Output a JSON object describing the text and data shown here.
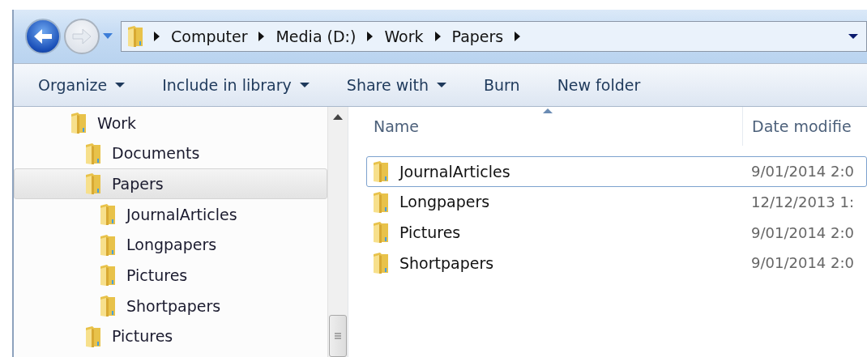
{
  "address_bar": {
    "crumbs": [
      "Computer",
      "Media (D:)",
      "Work",
      "Papers"
    ]
  },
  "toolbar": [
    {
      "label": "Organize",
      "dropdown": true
    },
    {
      "label": "Include in library",
      "dropdown": true
    },
    {
      "label": "Share with",
      "dropdown": true
    },
    {
      "label": "Burn",
      "dropdown": false
    },
    {
      "label": "New folder",
      "dropdown": false
    }
  ],
  "tree": [
    {
      "label": "Work",
      "selected": false,
      "children": [
        {
          "label": "Documents",
          "selected": false
        },
        {
          "label": "Papers",
          "selected": true,
          "children": [
            {
              "label": "JournalArticles",
              "selected": false
            },
            {
              "label": "Longpapers",
              "selected": false
            },
            {
              "label": "Pictures",
              "selected": false
            },
            {
              "label": "Shortpapers",
              "selected": false
            }
          ]
        },
        {
          "label": "Pictures",
          "selected": false
        }
      ]
    }
  ],
  "file_list": {
    "columns": [
      "Name",
      "Date modifie"
    ],
    "rows": [
      {
        "name": "JournalArticles",
        "date": "9/01/2014 2:0",
        "focused": true
      },
      {
        "name": "Longpapers",
        "date": "12/12/2013 1:",
        "focused": false
      },
      {
        "name": "Pictures",
        "date": "9/01/2014 2:0",
        "focused": false
      },
      {
        "name": "Shortpapers",
        "date": "9/01/2014 2:0",
        "focused": false
      }
    ]
  }
}
